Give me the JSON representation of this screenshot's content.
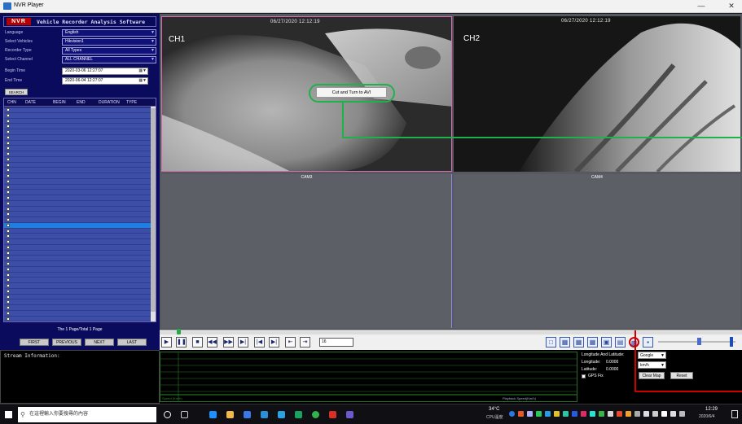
{
  "window": {
    "title": "NVR Player"
  },
  "header": {
    "logo": "NVR",
    "subtitle": "Vehicle Recorder Analysis Software"
  },
  "form": [
    {
      "label": "Language",
      "value": "English",
      "white": false
    },
    {
      "label": "Select Vehicles",
      "value": "Hikvision1",
      "white": false
    },
    {
      "label": "Recorder Type",
      "value": "All Types",
      "white": false
    },
    {
      "label": "Select Channel",
      "value": "ALL CHANNEL",
      "white": false
    },
    {
      "label": "Begin Time",
      "value": "2020-03-06 12:27:07",
      "white": true
    },
    {
      "label": "End Time",
      "value": "2020-06-04 12:27:07",
      "white": true
    }
  ],
  "search_button": "SEARCH",
  "table": {
    "columns": [
      "CHN",
      "DATE",
      "BEGIN",
      "END",
      "DURATION",
      "TYPE"
    ],
    "highlighted_rows": [
      21
    ]
  },
  "pagination": {
    "info": "The 1 Page/Total 1 Page",
    "buttons": [
      "FIRST",
      "PREVIOUS",
      "NEXT",
      "LAST"
    ]
  },
  "stream_info_label": "Stream Information:",
  "cameras": [
    {
      "label": "CH1",
      "title": "",
      "timestamp": "06/27/2020 12:12:19"
    },
    {
      "label": "CH2",
      "title": "",
      "timestamp": "06/27/2020 12:12:19"
    },
    {
      "label": "",
      "title": "CAM3",
      "timestamp": ""
    },
    {
      "label": "",
      "title": "CAM4",
      "timestamp": ""
    }
  ],
  "context_menu": {
    "item": "Cut and Turn to AVI"
  },
  "playback": {
    "speed_value": "16"
  },
  "gps": {
    "title": "Longitude And Latitude:",
    "longitude_label": "Longitude:",
    "longitude_value": "0.0000",
    "latitude_label": "Latitude:",
    "latitude_value": "0.0000",
    "gps_fix_label": "GPS Fix",
    "map_select": "Google",
    "unit_select": "km/h",
    "clear_button": "Clear Map",
    "reset_button": "Reset"
  },
  "graph": {
    "speed_label": "Speed (Km/h)",
    "playback_label": "Playback Speed(Km/h)"
  },
  "taskbar": {
    "search_placeholder": "在這裡輸入你要搜尋的內容",
    "temp": "34°C",
    "cpu": "CPU溫度",
    "time": "12:29",
    "date": "2020/6/4"
  },
  "colors": {
    "panel": "#0b0b5e",
    "rows": "#3c4ea8",
    "highlight_row": "#1f7fe0",
    "green_annotation": "#1db34a",
    "red_annotation": "#cc0000"
  }
}
